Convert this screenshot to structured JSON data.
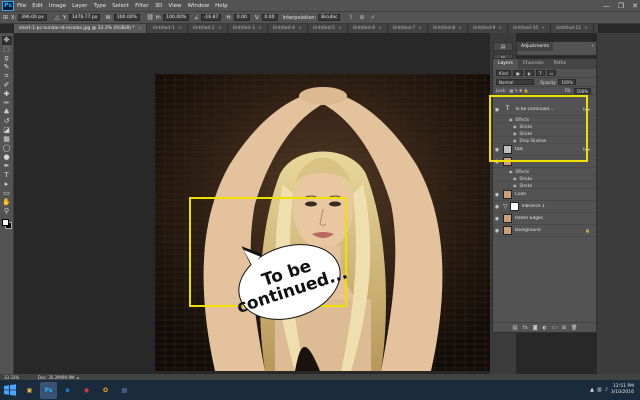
{
  "app": {
    "logo": "Ps",
    "menu": [
      "File",
      "Edit",
      "Image",
      "Layer",
      "Type",
      "Select",
      "Filter",
      "3D",
      "View",
      "Window",
      "Help"
    ],
    "window_controls": [
      "—",
      "❐",
      "✕"
    ]
  },
  "options_bar": {
    "x_label": "X:",
    "x_value": "396.00 px",
    "y_label": "Y:",
    "y_value": "1476.77 px",
    "w_label": "W:",
    "w_value": "100.00%",
    "h_label": "H:",
    "h_value": "100.00%",
    "angle_label": "∠",
    "angle_value": "-16.87",
    "hskew_label": "H:",
    "hskew_value": "0.00",
    "vskew_label": "V:",
    "vskew_value": "0.00",
    "interpolation_label": "Interpolation:",
    "interpolation_value": "Bicubic"
  },
  "tabs": [
    {
      "label": "short-1-pc-sundar-st-nicolas.jpg @ 33.3% (RGB/8) *",
      "active": true
    },
    {
      "label": "Untitled-1",
      "active": false
    },
    {
      "label": "Untitled-2",
      "active": false
    },
    {
      "label": "Untitled-3",
      "active": false
    },
    {
      "label": "Untitled-4",
      "active": false
    },
    {
      "label": "Untitled-5",
      "active": false
    },
    {
      "label": "Untitled-6",
      "active": false
    },
    {
      "label": "Untitled-7",
      "active": false
    },
    {
      "label": "Untitled-8",
      "active": false
    },
    {
      "label": "Untitled-9",
      "active": false
    },
    {
      "label": "Untitled-10",
      "active": false
    },
    {
      "label": "Untitled-11",
      "active": false
    },
    {
      "label": "Untitled-12",
      "active": false
    },
    {
      "label": "Untitled-13",
      "active": false
    },
    {
      "label": "Untitled-14",
      "active": false
    }
  ],
  "tools": [
    "move-tool",
    "marquee-tool",
    "lasso-tool",
    "quick-select-tool",
    "crop-tool",
    "eyedropper-tool",
    "healing-brush-tool",
    "brush-tool",
    "clone-stamp-tool",
    "history-brush-tool",
    "eraser-tool",
    "gradient-tool",
    "blur-tool",
    "dodge-tool",
    "pen-tool",
    "type-tool",
    "path-select-tool",
    "shape-tool",
    "hand-tool",
    "zoom-tool"
  ],
  "tool_glyphs": [
    "✥",
    "⬚",
    "ϙ",
    "✎",
    "⌗",
    "✐",
    "✚",
    "✏",
    "♣",
    "↺",
    "◪",
    "▦",
    "◯",
    "●",
    "✒",
    "T",
    "▸",
    "▭",
    "✋",
    "⚲"
  ],
  "swatches": {
    "foreground": "#ffffff",
    "background": "#000000"
  },
  "canvas": {
    "bubble_text": "To be\ncontinued..."
  },
  "adjustments_panel": {
    "tab": "Adjustments"
  },
  "layers_panel": {
    "tabs": [
      "Layers",
      "Channels",
      "Paths"
    ],
    "filter_kind": "Kind",
    "blend_mode": "Normal",
    "opacity_label": "Opacity:",
    "opacity_value": "100%",
    "lock_label": "Lock:",
    "fill_label": "Fill:",
    "fill_value": "100%",
    "layers": [
      {
        "name": "To be continued....",
        "kind": "type",
        "fx": true,
        "effects_label": "Effects",
        "effects": [
          "Stroke",
          "Stroke",
          "Drop Shadow"
        ]
      },
      {
        "name": "talk",
        "kind": "pattern",
        "fx": true,
        "effects_label": "",
        "effects": []
      },
      {
        "name": "",
        "kind": "face",
        "fx": false,
        "effects_label": "Effects",
        "effects": [
          "Stroke",
          "Stroke"
        ]
      },
      {
        "name": "Color",
        "kind": "face",
        "fx": false,
        "effects_label": "",
        "effects": []
      },
      {
        "name": "Vibrance 1",
        "kind": "adjustment",
        "fx": false,
        "effects_label": "",
        "effects": []
      },
      {
        "name": "Poster Edges",
        "kind": "face",
        "fx": false,
        "effects_label": "",
        "effects": []
      },
      {
        "name": "Background",
        "kind": "face",
        "fx": false,
        "locked": true,
        "effects_label": "",
        "effects": []
      }
    ],
    "footer_icons": [
      "link-icon",
      "fx-icon",
      "mask-icon",
      "adjustment-icon",
      "folder-icon",
      "new-layer-icon",
      "trash-icon"
    ],
    "footer_glyphs": [
      "⛓",
      "fx",
      "◙",
      "◐",
      "▭",
      "⊞",
      "🗑"
    ]
  },
  "status": {
    "zoom": "33.33%",
    "doc": "Doc: 35.2M/90.9M"
  },
  "taskbar": {
    "apps": [
      {
        "name": "file-explorer-icon",
        "glyph": "▣",
        "color": "#e8b84a",
        "active": false
      },
      {
        "name": "photoshop-icon",
        "glyph": "Ps",
        "color": "#31a8ff",
        "active": true
      },
      {
        "name": "internet-explorer-icon",
        "glyph": "e",
        "color": "#1e90ff",
        "active": false
      },
      {
        "name": "chrome-icon",
        "glyph": "◉",
        "color": "#e8453c",
        "active": false
      },
      {
        "name": "outlook-icon",
        "glyph": "O",
        "color": "#f0a030",
        "active": false
      },
      {
        "name": "app-icon",
        "glyph": "▤",
        "color": "#6a8acd",
        "active": false
      }
    ],
    "time": "12:51 PM",
    "date": "3/10/2016"
  },
  "colors": {
    "highlight": "#f0e000",
    "panel": "#535353",
    "workspace": "#282828"
  }
}
